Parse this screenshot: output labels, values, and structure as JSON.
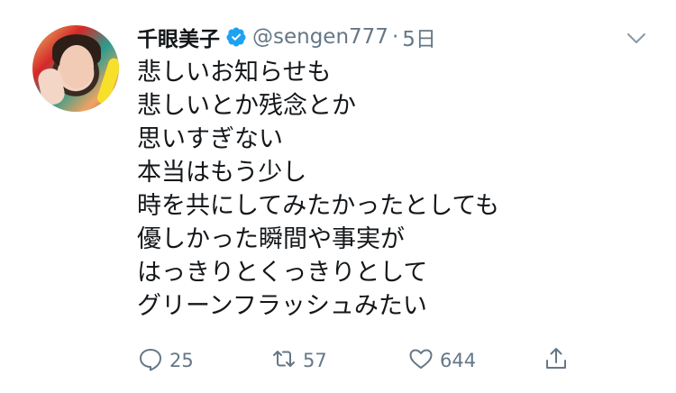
{
  "author": {
    "display_name": "千眼美子",
    "handle": "@sengen777",
    "separator": "·",
    "timestamp": "5日",
    "verified": true
  },
  "tweet": {
    "lines": [
      "悲しいお知らせも",
      "悲しいとか残念とか",
      "思いすぎない",
      "本当はもう少し",
      "時を共にしてみたかったとしても",
      "優しかった瞬間や事実が",
      "はっきりとくっきりとして",
      "グリーンフラッシュみたい"
    ]
  },
  "actions": {
    "replies": "25",
    "retweets": "57",
    "likes": "644"
  },
  "icons": {
    "verified": "verified-badge-icon",
    "menu": "chevron-down-icon",
    "reply": "reply-icon",
    "retweet": "retweet-icon",
    "like": "heart-icon",
    "share": "share-icon"
  },
  "colors": {
    "text": "#14171a",
    "secondary": "#657786",
    "verified": "#1da1f2"
  }
}
